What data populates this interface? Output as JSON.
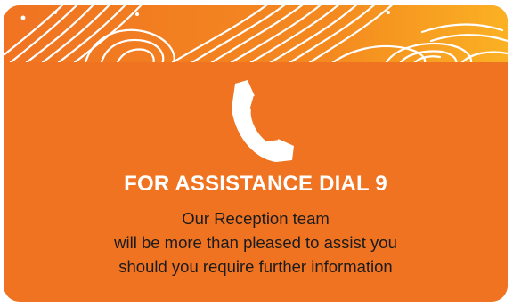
{
  "card": {
    "background_color": "#f07322",
    "pattern_color": "#ffffff",
    "icon": "phone-handset-icon"
  },
  "heading": "FOR ASSISTANCE DIAL 9",
  "message": {
    "line1": "Our Reception team",
    "line2": "will be more than pleased to assist you",
    "line3": "should you require further information"
  }
}
